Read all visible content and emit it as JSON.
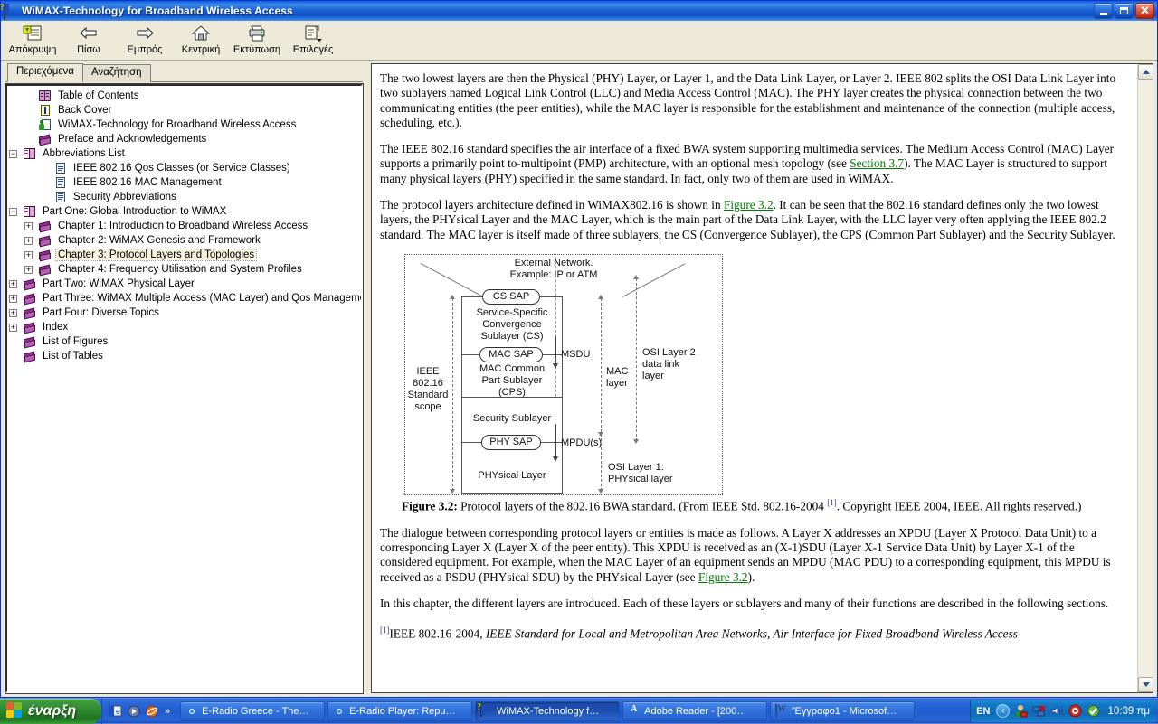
{
  "window": {
    "title": "WiMAX-Technology for Broadband Wireless Access",
    "icon": "help-book-icon",
    "minimize_label": "",
    "maximize_label": "",
    "close_label": "✕"
  },
  "toolbar": {
    "buttons": [
      {
        "label": "Απόκρυψη",
        "icon": "hide-pane-icon"
      },
      {
        "label": "Πίσω",
        "icon": "back-arrow-icon"
      },
      {
        "label": "Εμπρός",
        "icon": "forward-arrow-icon"
      },
      {
        "label": "Κεντρική",
        "icon": "home-icon"
      },
      {
        "label": "Εκτύπωση",
        "icon": "printer-icon"
      },
      {
        "label": "Επιλογές",
        "icon": "options-icon"
      }
    ]
  },
  "nav": {
    "tabs": [
      {
        "label": "Περιεχόμενα",
        "active": true
      },
      {
        "label": "Αναζήτηση",
        "active": false
      }
    ],
    "tree": [
      {
        "label": "Table of Contents",
        "indent": 1,
        "expander": "",
        "icon": "toc-icon",
        "selected": false
      },
      {
        "label": "Back Cover",
        "indent": 1,
        "expander": "",
        "icon": "info-icon",
        "selected": false
      },
      {
        "label": "WiMAX-Technology for Broadband Wireless Access",
        "indent": 1,
        "expander": "",
        "icon": "person-doc-icon",
        "selected": false
      },
      {
        "label": "Preface and Acknowledgements",
        "indent": 1,
        "expander": "",
        "icon": "book-icon",
        "selected": false
      },
      {
        "label": "Abbreviations List",
        "indent": 0,
        "expander": "−",
        "icon": "open-book-icon",
        "selected": false
      },
      {
        "label": "IEEE 802.16 Qos Classes (or Service Classes)",
        "indent": 2,
        "expander": "",
        "icon": "page-icon",
        "selected": false
      },
      {
        "label": "IEEE 802.16 MAC Management",
        "indent": 2,
        "expander": "",
        "icon": "page-icon",
        "selected": false
      },
      {
        "label": "Security Abbreviations",
        "indent": 2,
        "expander": "",
        "icon": "page-icon",
        "selected": false
      },
      {
        "label": "Part One: Global Introduction to WiMAX",
        "indent": 0,
        "expander": "−",
        "icon": "open-book-icon",
        "selected": false
      },
      {
        "label": "Chapter 1: Introduction to Broadband Wireless Access",
        "indent": 1,
        "expander": "+",
        "icon": "book-icon",
        "selected": false
      },
      {
        "label": "Chapter 2: WiMAX Genesis and Framework",
        "indent": 1,
        "expander": "+",
        "icon": "book-icon",
        "selected": false
      },
      {
        "label": "Chapter 3: Protocol Layers and Topologies",
        "indent": 1,
        "expander": "+",
        "icon": "book-icon",
        "selected": true
      },
      {
        "label": "Chapter 4: Frequency Utilisation and System Profiles",
        "indent": 1,
        "expander": "+",
        "icon": "book-icon",
        "selected": false
      },
      {
        "label": "Part Two: WiMAX Physical Layer",
        "indent": 0,
        "expander": "+",
        "icon": "book-icon",
        "selected": false
      },
      {
        "label": "Part Three: WiMAX Multiple Access (MAC Layer) and Qos Management",
        "indent": 0,
        "expander": "+",
        "icon": "book-icon",
        "selected": false
      },
      {
        "label": "Part Four: Diverse Topics",
        "indent": 0,
        "expander": "+",
        "icon": "book-icon",
        "selected": false
      },
      {
        "label": "Index",
        "indent": 0,
        "expander": "+",
        "icon": "book-icon",
        "selected": false
      },
      {
        "label": "List of Figures",
        "indent": 0,
        "expander": "",
        "icon": "book-icon",
        "selected": false
      },
      {
        "label": "List of Tables",
        "indent": 0,
        "expander": "",
        "icon": "book-icon",
        "selected": false
      }
    ]
  },
  "content": {
    "para1_a": "The two lowest layers are then the Physical (PHY) Layer, or Layer 1, and the Data Link Layer, or Layer 2. IEEE 802 splits the OSI Data Link Layer into two sublayers named Logical Link Control (LLC) and Media Access Control (MAC). The PHY layer creates the physical connection between the two communicating entities (the peer entities), while the MAC layer is responsible for the establishment and maintenance of the connection (multiple access, scheduling, etc.).",
    "para2_a": "The IEEE 802.16 standard specifies the air interface of a fixed BWA system supporting multimedia services. The Medium Access Control (MAC) Layer supports a primarily point to-multipoint (PMP) architecture, with an optional mesh topology (see ",
    "para2_link": "Section 3.7",
    "para2_b": "). The MAC Layer is structured to support many physical layers (PHY) specified in the same standard. In fact, only two of them are used in WiMAX.",
    "para3_a": "The protocol layers architecture defined in WiMAX802.16 is shown in ",
    "para3_link": "Figure 3.2",
    "para3_b": ". It can be seen that the 802.16 standard defines only the two lowest layers, the PHYsical Layer and the MAC Layer, which is the main part of the Data Link Layer, with the LLC layer very often applying the IEEE 802.2 standard. The MAC layer is itself made of three sublayers, the CS (Convergence Sublayer), the CPS (Common Part Sublayer) and the Security Sublayer.",
    "figure_caption_label": "Figure 3.2:",
    "figure_caption_a": " Protocol layers of the 802.16 BWA standard. (From IEEE Std. 802.16-2004 ",
    "figure_caption_fn": "[1]",
    "figure_caption_b": ". Copyright IEEE 2004, IEEE. All rights reserved.)",
    "para4_a": "The dialogue between corresponding protocol layers or entities is made as follows. A Layer X addresses an XPDU (Layer X Protocol Data Unit) to a corresponding Layer X (Layer X of the peer entity). This XPDU is received as an (X-1)SDU (Layer X-1 Service Data Unit) by Layer X-1 of the considered equipment. For example, when the MAC Layer of an equipment sends an MPDU (MAC PDU) to a corresponding equipment, this MPDU is received as a PSDU (PHYsical SDU) by the PHYsical Layer (see ",
    "para4_link": "Figure 3.2",
    "para4_b": ").",
    "para5": "In this chapter, the different layers are introduced. Each of these layers or sublayers and many of their functions are described in the following sections.",
    "footnote_marker": "[1]",
    "footnote_a": "IEEE 802.16-2004, ",
    "footnote_italic": "IEEE Standard for Local and Metropolitan Area Networks, Air Interface for Fixed Broadband Wireless Access",
    "link_color": "#007a00"
  },
  "figure": {
    "external_network_l1": "External Network.",
    "external_network_l2": "Example: IP or ATM",
    "cs_sap": "CS SAP",
    "cs_l1": "Service-Specific",
    "cs_l2": "Convergence",
    "cs_l3": "Sublayer (CS)",
    "mac_sap": "MAC SAP",
    "cps_l1": "MAC Common",
    "cps_l2": "Part Sublayer",
    "cps_l3": "(CPS)",
    "security_sublayer": "Security Sublayer",
    "phy_sap": "PHY SAP",
    "phy_layer": "PHYsical Layer",
    "msdu": "MSDU",
    "mpdus": "MPDU(s)",
    "scope_l1": "IEEE",
    "scope_l2": "802.16",
    "scope_l3": "Standard",
    "scope_l4": "scope",
    "mac_layer_l1": "MAC",
    "mac_layer_l2": "layer",
    "osi2_l1": "OSI Layer 2",
    "osi2_l2": "data link",
    "osi2_l3": "layer",
    "osi1_l1": "OSI Layer 1:",
    "osi1_l2": "PHYsical layer"
  },
  "scrollbar": {
    "up_glyph": "▲",
    "down_glyph": "▼"
  },
  "taskbar": {
    "start_label": "έναρξη",
    "quicklaunch_overflow": "»",
    "tasks": [
      {
        "label": "E-Radio Greece - The…",
        "icon": "chrome-icon",
        "active": false
      },
      {
        "label": "E-Radio Player: Repu…",
        "icon": "chrome-icon",
        "active": false
      },
      {
        "label": "WiMAX-Technology f…",
        "icon": "help-book-icon",
        "active": true
      },
      {
        "label": "Adobe Reader - [200…",
        "icon": "acrobat-icon",
        "active": false
      },
      {
        "label": "'Έγγραφο1 - Microsof…",
        "icon": "word-icon",
        "active": false
      }
    ],
    "tray": {
      "language": "EN",
      "collapse_glyph": "‹",
      "clock": "10:39 πμ"
    }
  }
}
